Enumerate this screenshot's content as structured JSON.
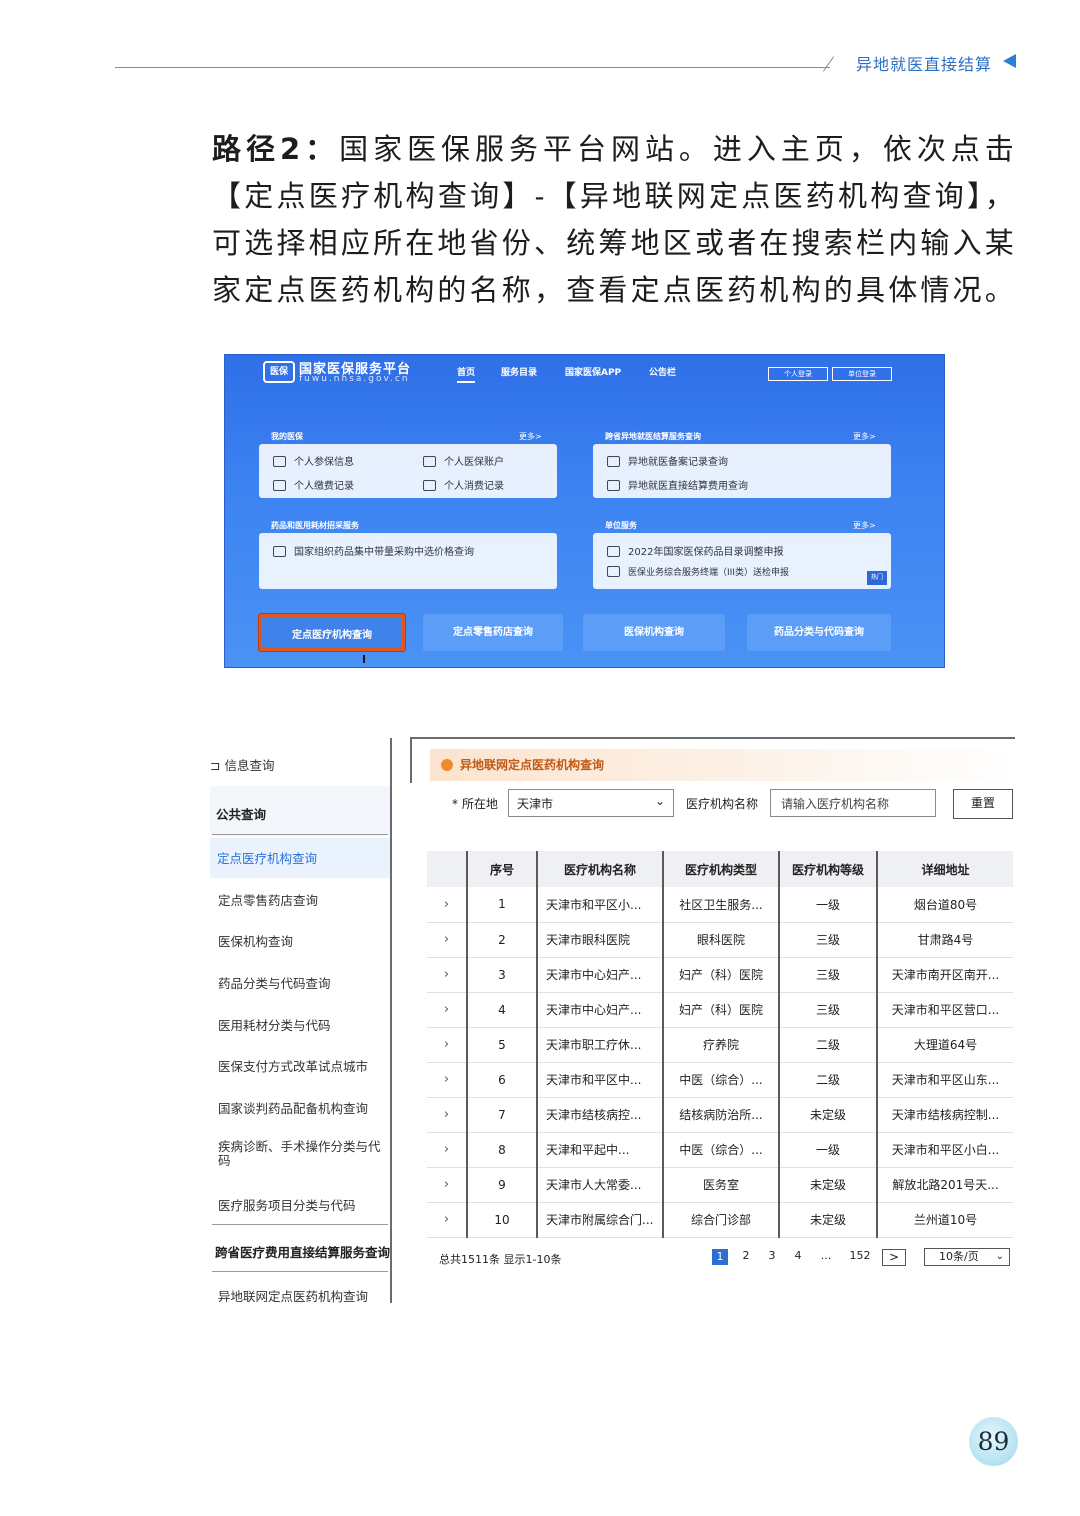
{
  "header": {
    "section_title": "异地就医直接结算"
  },
  "paragraph": {
    "lead": "路径2：",
    "body": "国家医保服务平台网站。进入主页，依次点击【定点医疗机构查询】-【异地联网定点医药机构查询】，可选择相应所在地省份、统筹地区或者在搜索栏内输入某家定点医药机构的名称，查看定点医药机构的具体情况。"
  },
  "portal": {
    "site_name": "国家医保服务平台",
    "site_url": "fuwu.nhsa.gov.cn",
    "logo_text": "医保",
    "nav": [
      "首页",
      "服务目录",
      "国家医保APP",
      "公告栏"
    ],
    "top_buttons": [
      "个人登录",
      "单位登录"
    ],
    "more_label": "更多>",
    "panels": [
      {
        "title": "我的医保",
        "items": [
          "个人参保信息",
          "个人医保账户",
          "个人缴费记录",
          "个人消费记录"
        ]
      },
      {
        "title": "跨省异地就医结算服务查询",
        "items": [
          "异地就医备案记录查询",
          "异地就医直接结算费用查询"
        ]
      },
      {
        "title": "药品和医用耗材招采服务",
        "items": [
          "国家组织药品集中带量采购中选价格查询"
        ]
      },
      {
        "title": "单位服务",
        "items": [
          "2022年国家医保药品目录调整申报",
          "医保业务综合服务终端（III类）送检申报"
        ],
        "badge": "热门"
      }
    ],
    "bottom_buttons": [
      "定点医疗机构查询",
      "定点零售药店查询",
      "医保机构查询",
      "药品分类与代码查询"
    ]
  },
  "sidebar": {
    "header": "信息查询",
    "group": "公共查询",
    "items": [
      "定点医疗机构查询",
      "定点零售药店查询",
      "医保机构查询",
      "药品分类与代码查询",
      "医用耗材分类与代码",
      "医保支付方式改革试点城市",
      "国家谈判药品配备机构查询",
      "疾病诊断、手术操作分类与代码",
      "医疗服务项目分类与代码"
    ],
    "footer_items": [
      "跨省医疗费用直接结算服务查询",
      "异地联网定点医药机构查询"
    ]
  },
  "query": {
    "title": "异地联网定点医药机构查询",
    "location_label": "* 所在地",
    "location_value": "天津市",
    "name_label": "医疗机构名称",
    "name_placeholder": "请输入医疗机构名称",
    "reset_label": "重置"
  },
  "table": {
    "columns": [
      "序号",
      "医疗机构名称",
      "医疗机构类型",
      "医疗机构等级",
      "详细地址"
    ],
    "rows": [
      [
        "1",
        "天津市和平区小...",
        "社区卫生服务...",
        "一级",
        "烟台道80号"
      ],
      [
        "2",
        "天津市眼科医院",
        "眼科医院",
        "三级",
        "甘肃路4号"
      ],
      [
        "3",
        "天津市中心妇产...",
        "妇产（科）医院",
        "三级",
        "天津市南开区南开..."
      ],
      [
        "4",
        "天津市中心妇产...",
        "妇产（科）医院",
        "三级",
        "天津市和平区营口..."
      ],
      [
        "5",
        "天津市职工疗休...",
        "疗养院",
        "二级",
        "大理道64号"
      ],
      [
        "6",
        "天津市和平区中...",
        "中医（综合）...",
        "二级",
        "天津市和平区山东..."
      ],
      [
        "7",
        "天津市结核病控...",
        "结核病防治所...",
        "未定级",
        "天津市结核病控制..."
      ],
      [
        "8",
        "天津和平起中...",
        "中医（综合）...",
        "一级",
        "天津市和平区小白..."
      ],
      [
        "9",
        "天津市人大常委...",
        "医务室",
        "未定级",
        "解放北路201号天..."
      ],
      [
        "10",
        "天津市附属综合门...",
        "综合门诊部",
        "未定级",
        "兰州道10号"
      ]
    ]
  },
  "pagination": {
    "summary": "总共1511条 显示1-10条",
    "pages": [
      "1",
      "2",
      "3",
      "4",
      "...",
      "152"
    ],
    "current": "1",
    "next": ">",
    "page_size": "10条/页"
  },
  "page_number": "89"
}
